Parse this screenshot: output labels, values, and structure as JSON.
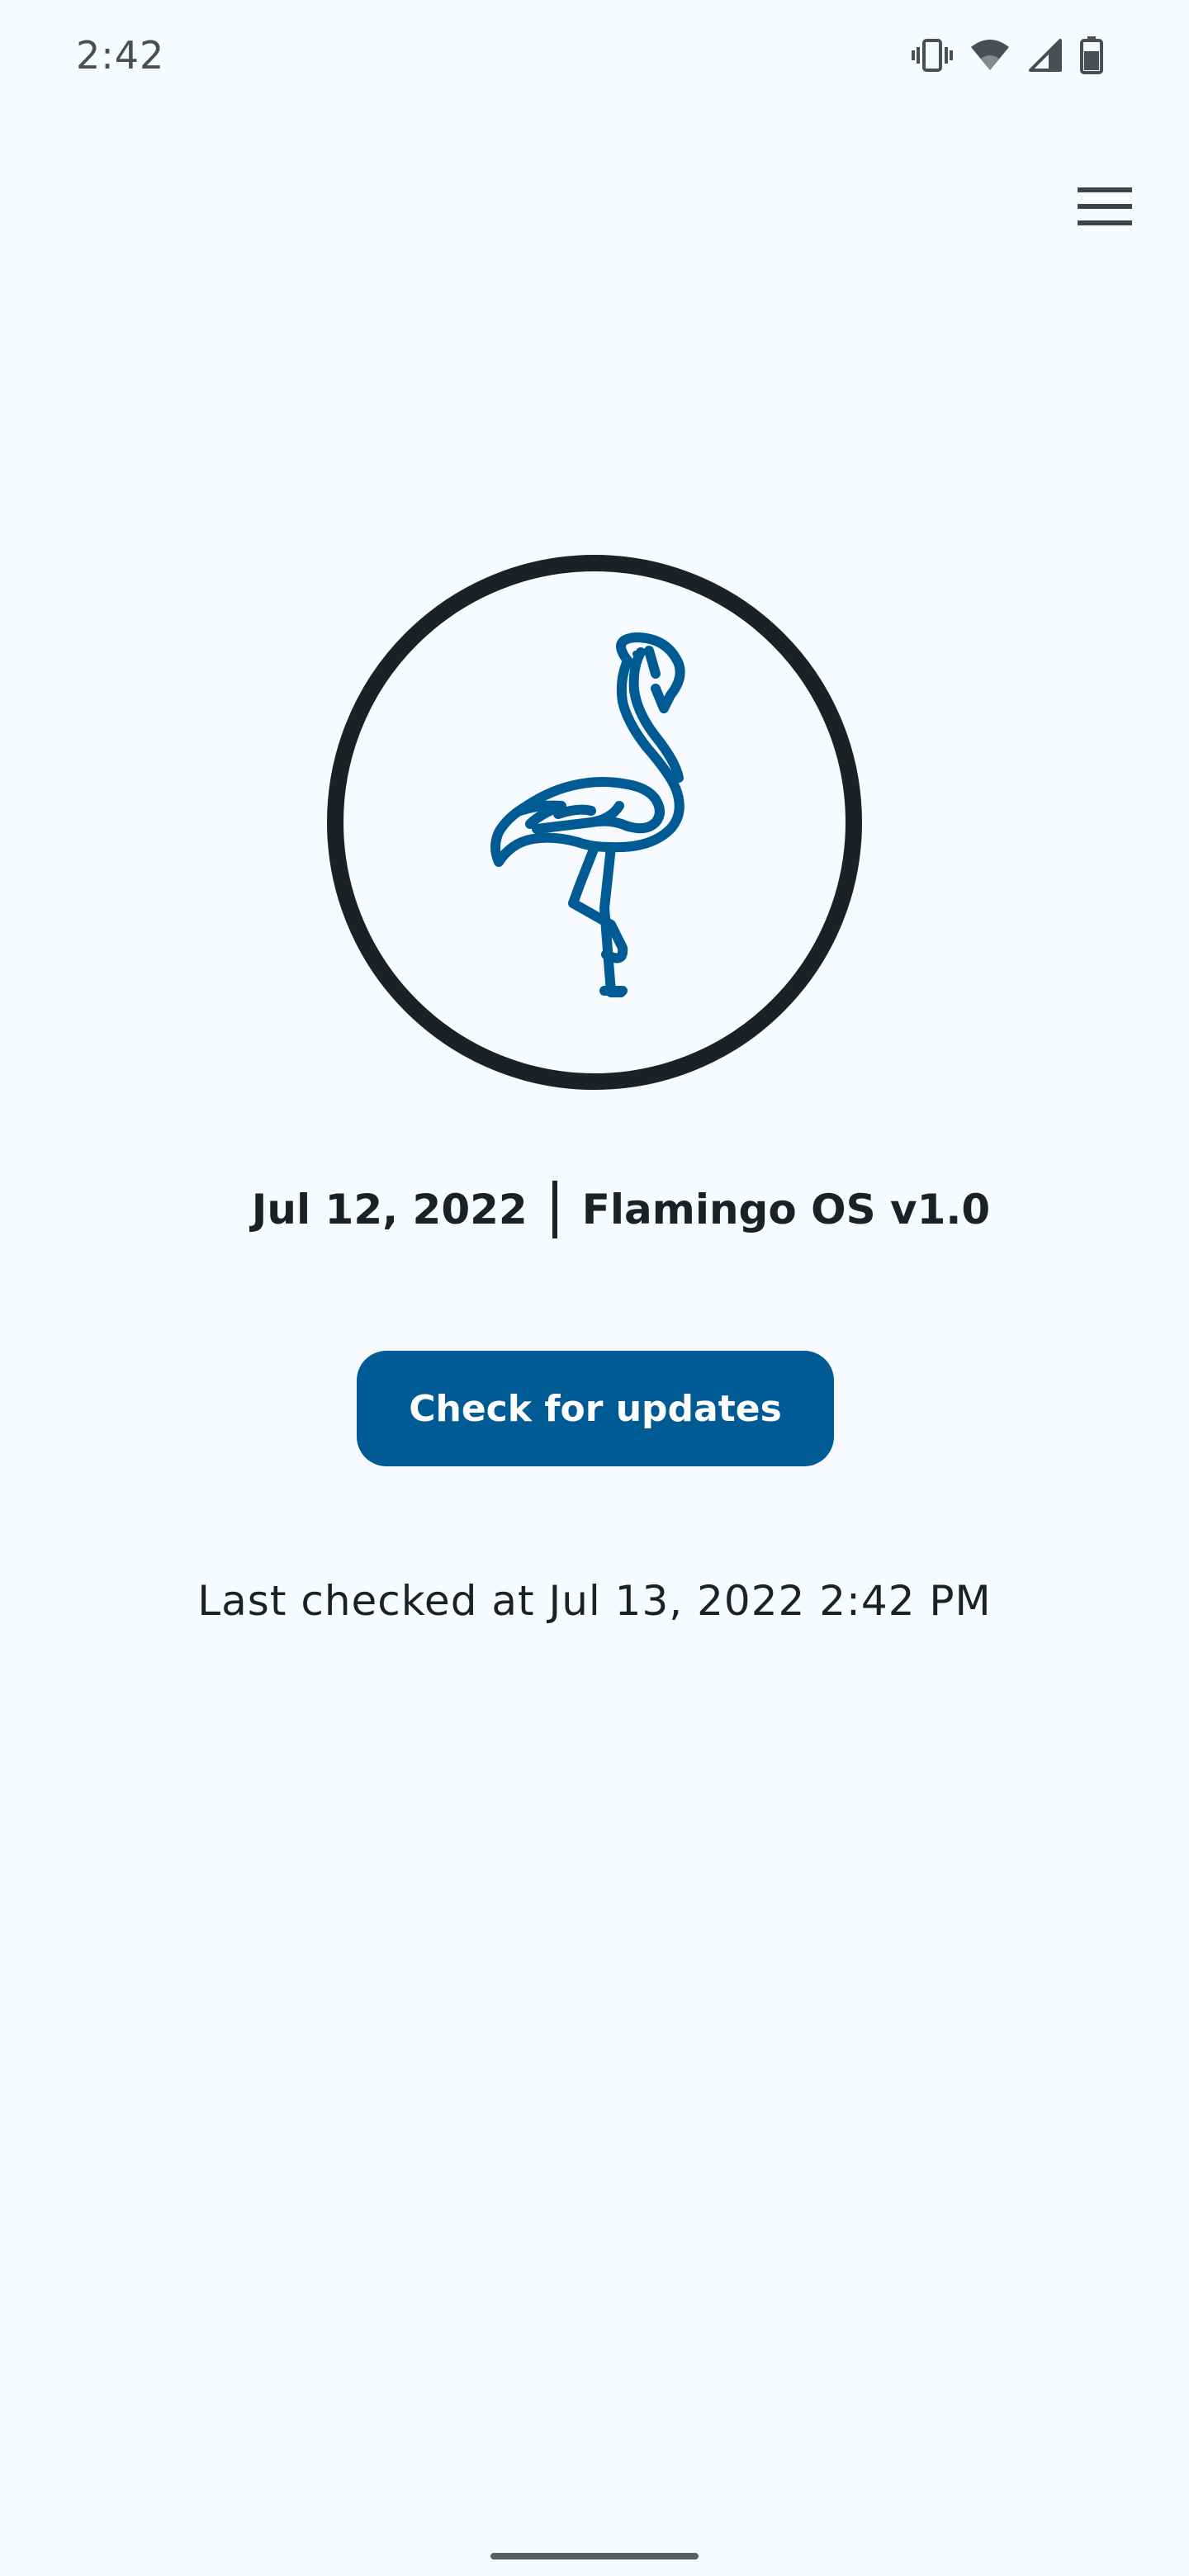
{
  "status_bar": {
    "time": "2:42",
    "icons": [
      "vibrate-icon",
      "wifi-icon",
      "signal-icon",
      "battery-icon"
    ]
  },
  "toolbar": {
    "menu_icon": "hamburger-menu-icon"
  },
  "logo": {
    "icon": "flamingo-icon",
    "accent_color": "#005a94",
    "ring_color": "#1d2126"
  },
  "build_info": {
    "date": "Jul 12, 2022",
    "version": "Flamingo OS v1.0"
  },
  "update": {
    "button_label": "Check for updates",
    "button_color": "#005a94",
    "last_checked": "Last checked at Jul 13, 2022 2:42 PM"
  }
}
